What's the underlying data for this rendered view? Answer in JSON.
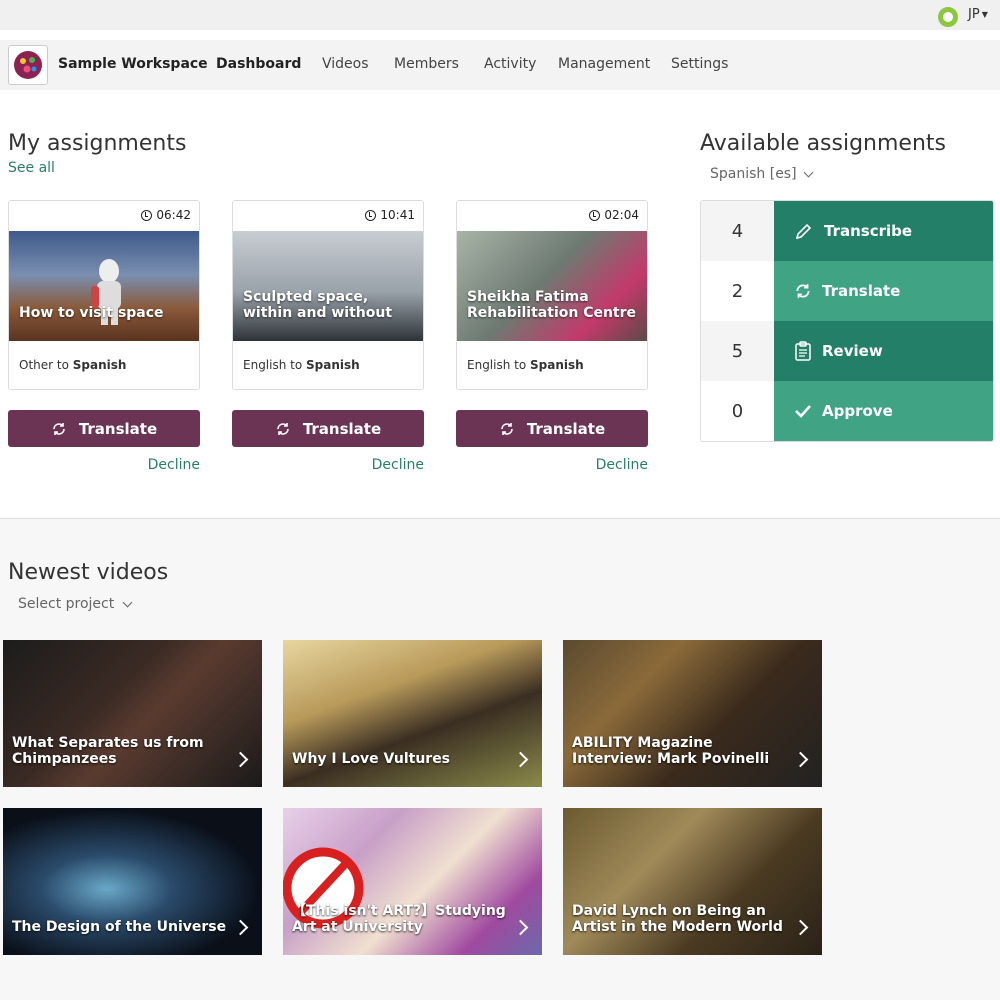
{
  "topbar": {
    "user_initials": "JP",
    "status_color": "#8dc63f"
  },
  "nav": {
    "workspace": "Sample Workspace",
    "items": [
      "Dashboard",
      "Videos",
      "Members",
      "Activity",
      "Management",
      "Settings"
    ],
    "active": "Dashboard"
  },
  "my_assignments": {
    "title": "My assignments",
    "see_all": "See all",
    "cards": [
      {
        "duration": "06:42",
        "title": "How to visit space",
        "from": "Other to ",
        "to": "Spanish",
        "action": "Translate",
        "decline": "Decline"
      },
      {
        "duration": "10:41",
        "title": "Sculpted space, within and without",
        "from": "English to ",
        "to": "Spanish",
        "action": "Translate",
        "decline": "Decline"
      },
      {
        "duration": "02:04",
        "title": "Sheikha Fatima Rehabilitation Centre",
        "from": "English to ",
        "to": "Spanish",
        "action": "Translate",
        "decline": "Decline"
      }
    ]
  },
  "available_assignments": {
    "title": "Available assignments",
    "language": "Spanish [es]",
    "rows": [
      {
        "count": "4",
        "label": "Transcribe",
        "icon": "pencil-icon",
        "color": "#237f68"
      },
      {
        "count": "2",
        "label": "Translate",
        "icon": "translate-icon",
        "color": "#3fa384"
      },
      {
        "count": "5",
        "label": "Review",
        "icon": "clipboard-icon",
        "color": "#237f68"
      },
      {
        "count": "0",
        "label": "Approve",
        "icon": "check-icon",
        "color": "#3fa384"
      }
    ]
  },
  "newest_videos": {
    "title": "Newest videos",
    "project_select": "Select project",
    "videos": [
      {
        "title": "What Separates us from Chimpanzees"
      },
      {
        "title": "Why I Love Vultures"
      },
      {
        "title": "ABILITY Magazine Interview: Mark Povinelli"
      },
      {
        "title": "The Design of the Universe"
      },
      {
        "title": "【This isn't ART?】Studying Art at University"
      },
      {
        "title": "David Lynch on Being an Artist in the Modern World"
      }
    ]
  },
  "colors": {
    "accent": "#2a7d6a",
    "button": "#6b3454"
  }
}
